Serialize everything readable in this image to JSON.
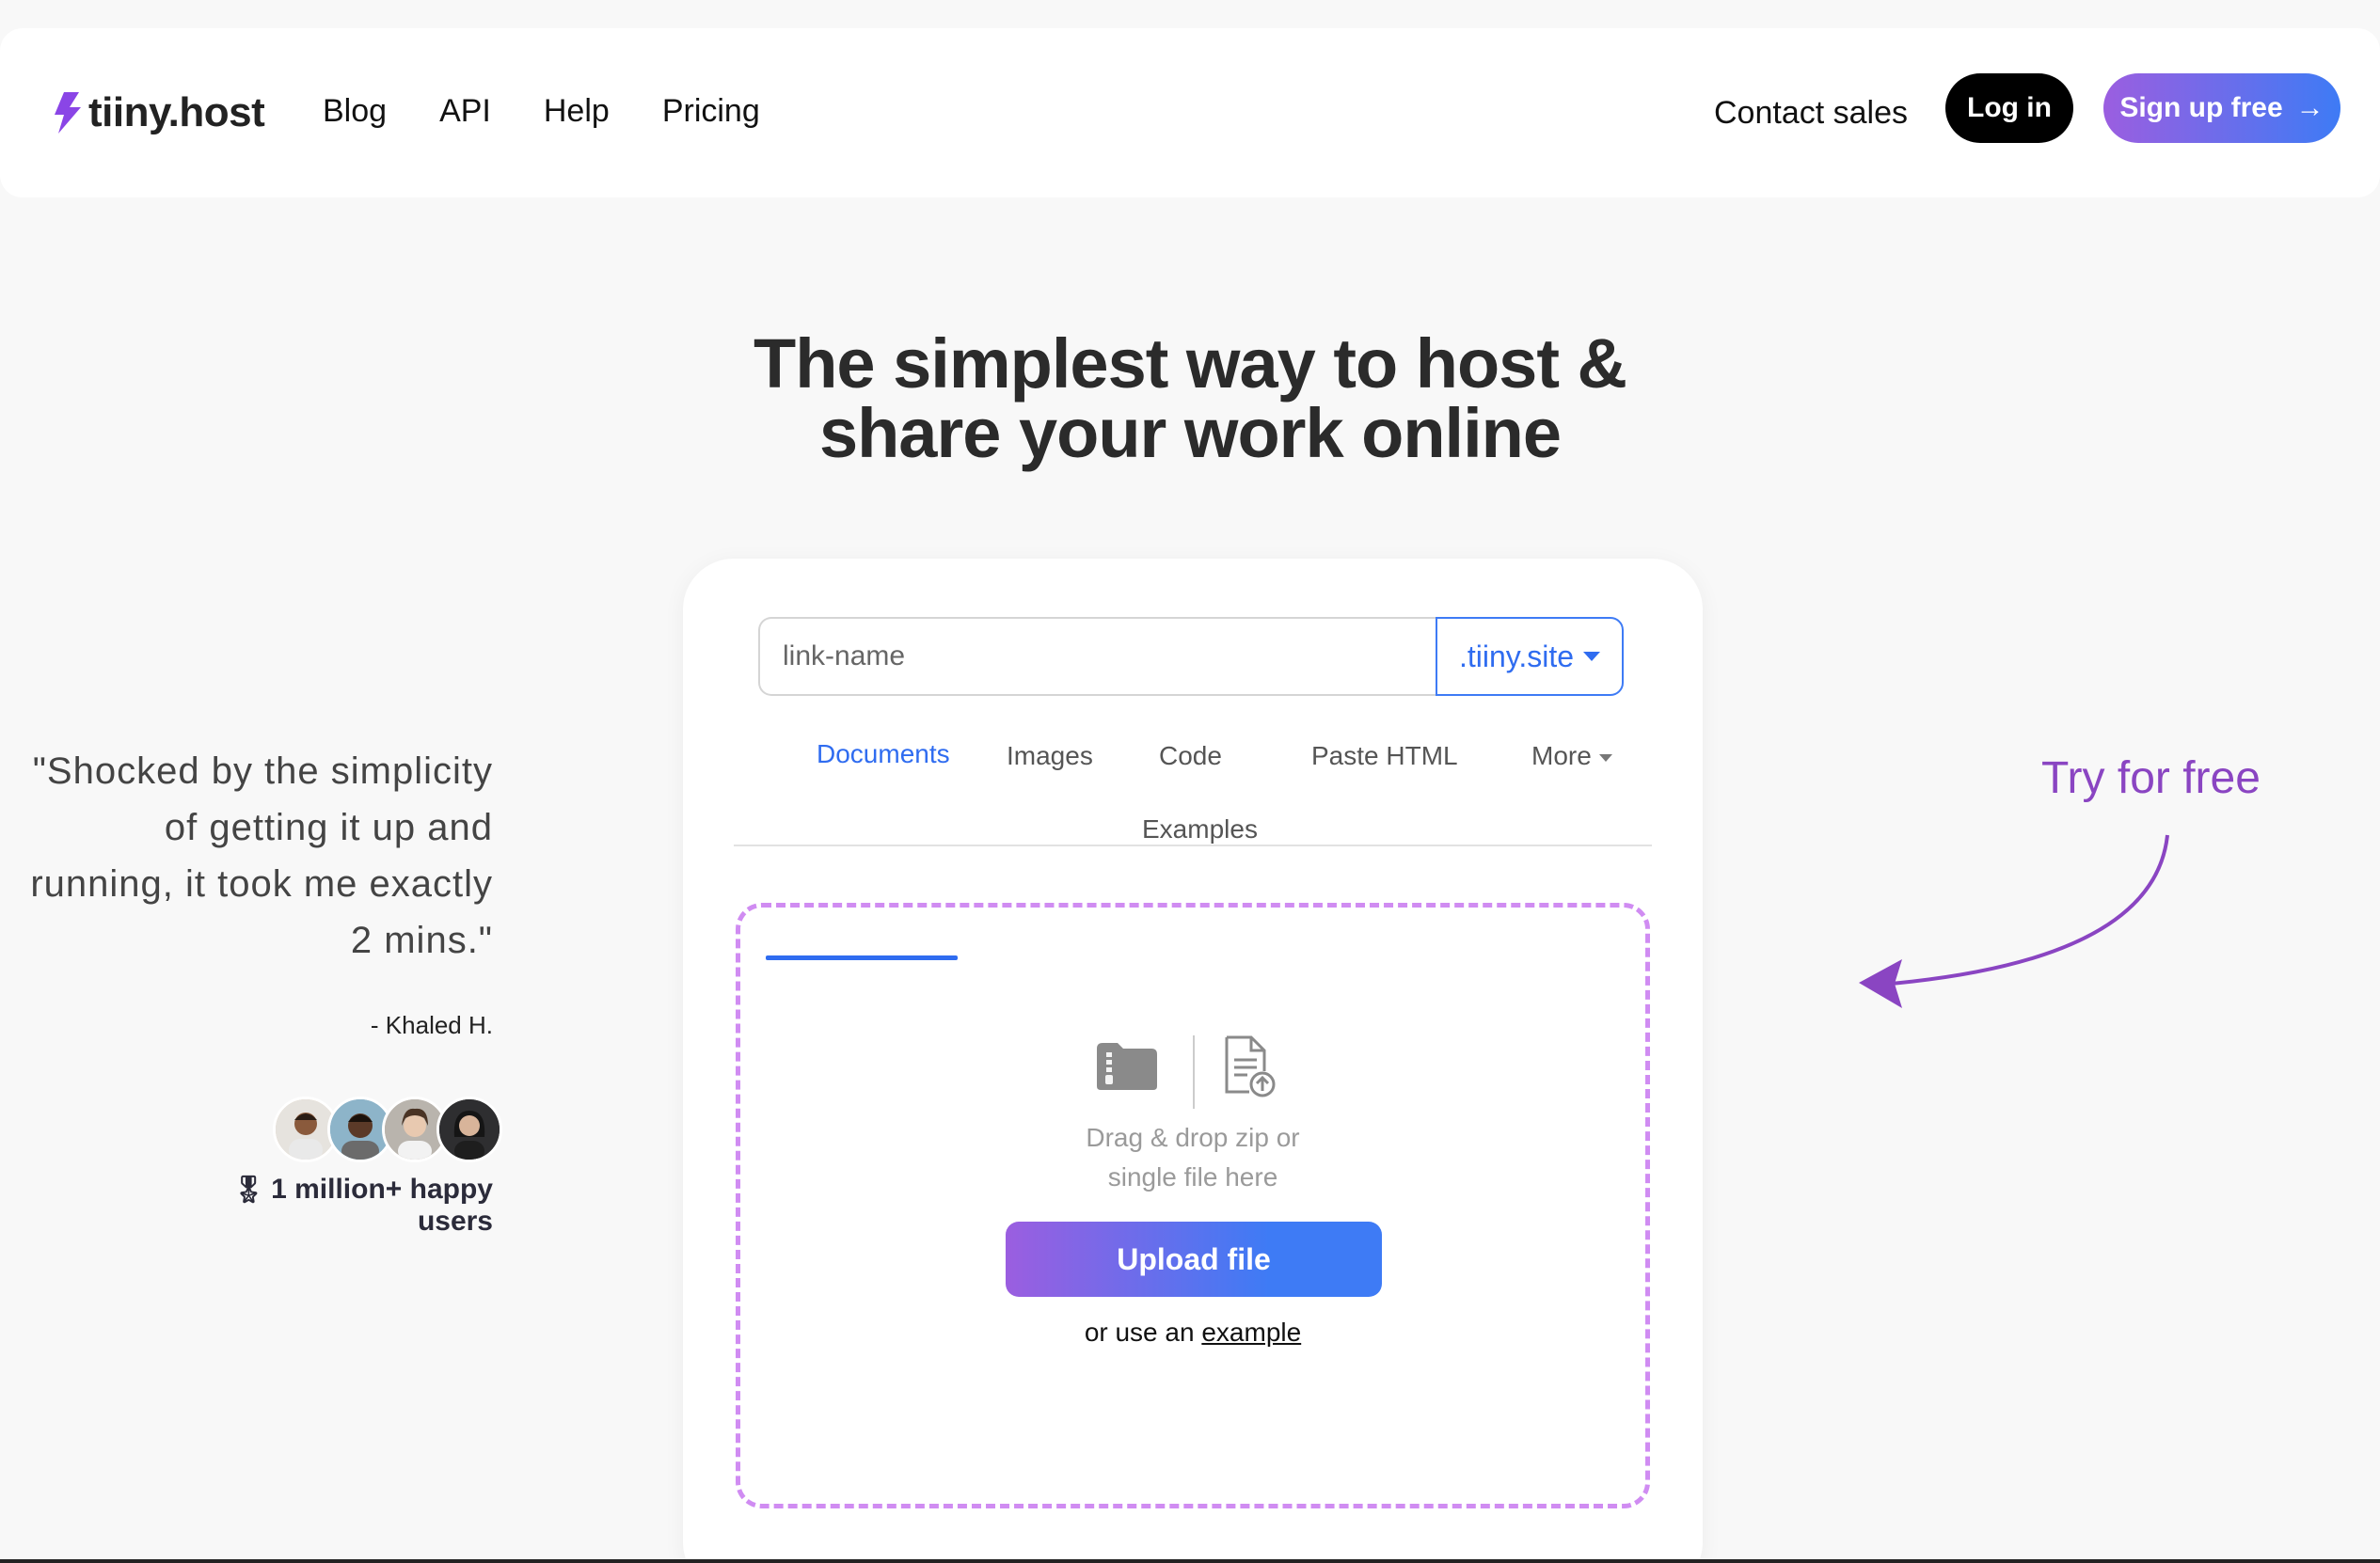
{
  "header": {
    "logo_text": "tiiny.host",
    "nav": [
      "Blog",
      "API",
      "Help",
      "Pricing"
    ],
    "contact_sales": "Contact sales",
    "login": "Log in",
    "signup": "Sign up free",
    "signup_arrow": "→"
  },
  "hero": {
    "title_line1": "The simplest way to host &",
    "title_line2": "share your work online"
  },
  "testimonial": {
    "quote": "\"Shocked by the simplicity of getting it up and running, it took me exactly 2 mins.\"",
    "author": "- Khaled H.",
    "users_badge": "1 million+ happy users",
    "medal": "🎖"
  },
  "upload_card": {
    "link_placeholder": "link-name",
    "domain": ".tiiny.site",
    "tabs": [
      "Documents",
      "Images",
      "Code",
      "Paste HTML",
      "More",
      "Examples"
    ],
    "active_tab": "Documents",
    "dropzone_line1": "Drag & drop zip or",
    "dropzone_line2": "single file here",
    "upload_button": "Upload file",
    "example_prefix": "or use an",
    "example_link": "example"
  },
  "callout": {
    "try_free": "Try for free"
  },
  "colors": {
    "accent_blue": "#2f6cf0",
    "accent_purple": "#9b5ee0",
    "callout_purple": "#8a45c2",
    "dropzone_border": "#d08cf2"
  },
  "icons": [
    "bolt-logo-icon",
    "zip-folder-icon",
    "file-upload-icon",
    "caret-down-icon",
    "curved-arrow-icon"
  ]
}
